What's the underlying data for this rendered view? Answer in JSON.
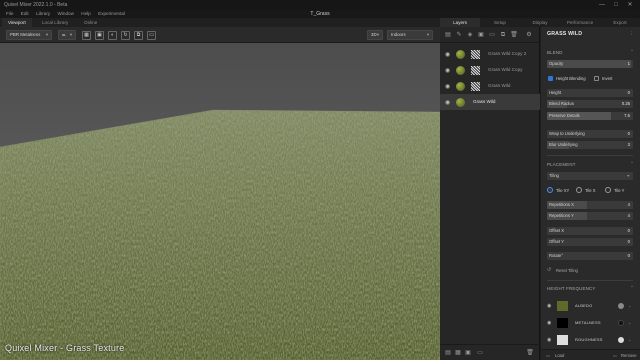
{
  "window": {
    "app_title": "Quixel Mixer 2022.1.0 - Beta",
    "document_title": "T_Grass",
    "controls": [
      "—",
      "□",
      "✕"
    ]
  },
  "menu": [
    "File",
    "Edit",
    "Library",
    "Window",
    "Help",
    "Experimental"
  ],
  "left_tabs": [
    {
      "label": "Viewport",
      "active": true
    },
    {
      "label": "Local Library",
      "active": false
    },
    {
      "label": "Online",
      "active": false
    }
  ],
  "toolbar": {
    "material_mode": "PBR Metalness",
    "view_mode": "3D",
    "environment": "Indoors",
    "tools": [
      "shape-icon",
      "layout-icon",
      "display-icon",
      "lighting-icon",
      "export-icon",
      "frame-icon"
    ]
  },
  "viewport": {
    "watermark": "Quixel Mixer - Grass Texture"
  },
  "right_tabs": [
    {
      "label": "Layers",
      "active": true
    },
    {
      "label": "Setup",
      "active": false
    },
    {
      "label": "Display",
      "active": false
    },
    {
      "label": "Performance",
      "active": false
    },
    {
      "label": "Export",
      "active": false
    }
  ],
  "layers": [
    {
      "name": "Grass Wild Copy 2",
      "selected": false
    },
    {
      "name": "Grass Wild Copy",
      "selected": false
    },
    {
      "name": "Grass Wild",
      "selected": false
    },
    {
      "name": "Grass Wild",
      "selected": true
    }
  ],
  "properties": {
    "title": "GRASS WILD",
    "blend": {
      "header": "BLEND",
      "opacity_label": "Opacity",
      "opacity_value": "1",
      "height_blending_label": "Height Blending",
      "height_blending": true,
      "invert_label": "Invert",
      "invert": false,
      "height_label": "Height",
      "height_value": "0",
      "blend_radius_label": "Blend Radius",
      "blend_radius_value": "0.25",
      "preserve_details_label": "Preserve Details",
      "preserve_details_value": "7.5",
      "wrap_label": "Wrap to Underlying",
      "wrap_value": "0",
      "blur_label": "Blur Underlying",
      "blur_value": "3"
    },
    "placement": {
      "header": "PLACEMENT",
      "mode": "Tiling",
      "tile_options": [
        "Tile XY",
        "Tile X",
        "Tile Y"
      ],
      "tile_selected": "Tile XY",
      "repetitions_x_label": "Repetitions X",
      "repetitions_x_value": "4",
      "repetitions_y_label": "Repetitions Y",
      "repetitions_y_value": "4",
      "offset_x_label": "Offset X",
      "offset_x_value": "0",
      "offset_y_label": "Offset Y",
      "offset_y_value": "0",
      "rotate_label": "Rotate°",
      "rotate_value": "0",
      "reset_label": "Reset Tiling"
    },
    "height_frequency": {
      "header": "HEIGHT FREQUENCY",
      "channels": [
        {
          "name": "ALBEDO",
          "swatch": "#5d6a2a",
          "dot": "#8a8a8a"
        },
        {
          "name": "METALNESS",
          "swatch": "#000000",
          "dot": "#111111"
        },
        {
          "name": "ROUGHNESS",
          "swatch": "#dddddd",
          "dot": "#dddddd"
        }
      ]
    },
    "footer": {
      "left": "Load",
      "right": "Remove"
    }
  }
}
